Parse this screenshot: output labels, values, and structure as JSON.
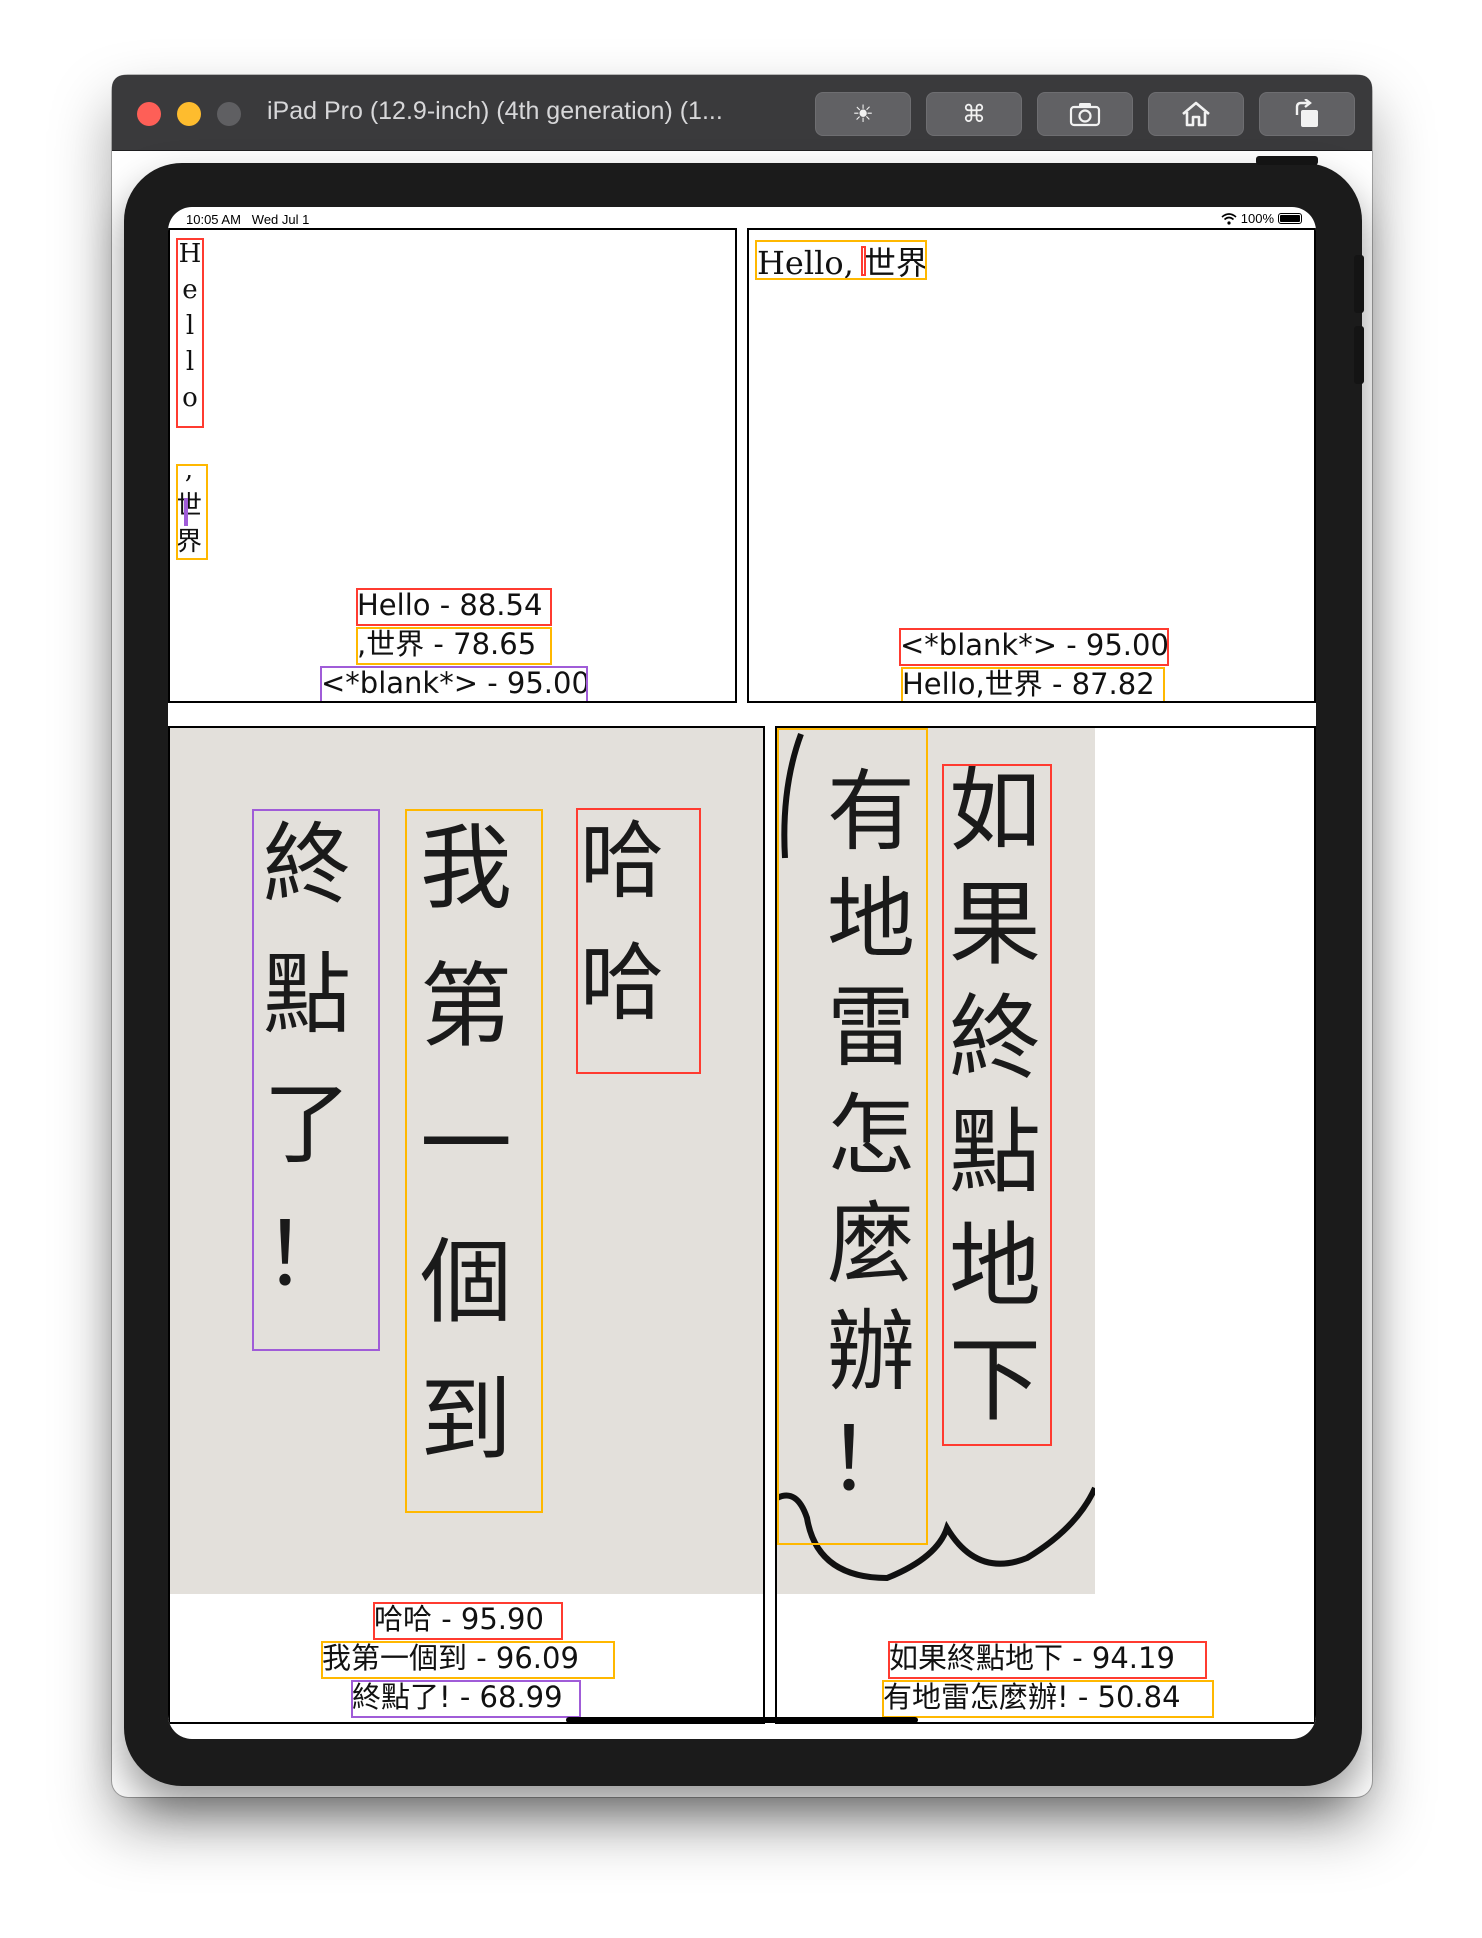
{
  "window": {
    "title": "iPad Pro (12.9-inch) (4th generation) (1...",
    "toolbar": [
      {
        "name": "brightness-button",
        "icon": "sun-icon",
        "glyph": "☀"
      },
      {
        "name": "command-button",
        "icon": "command-icon",
        "glyph": "⌘"
      },
      {
        "name": "screenshot-button",
        "icon": "camera-icon",
        "glyph": "📷"
      },
      {
        "name": "home-button",
        "icon": "home-icon",
        "glyph": "⌂"
      },
      {
        "name": "rotate-button",
        "icon": "rotate-icon",
        "glyph": "↻"
      }
    ]
  },
  "status_bar": {
    "time": "10:05 AM",
    "date": "Wed Jul 1",
    "battery": "100%"
  },
  "panels": {
    "top_left": {
      "vertical_hello": [
        "H",
        "e",
        "l",
        "l",
        "o"
      ],
      "vertical_world": [
        ",",
        "世",
        "界"
      ],
      "results": [
        "Hello - 88.54",
        ",世界 - 78.65",
        "<*blank*> - 95.00"
      ]
    },
    "top_right": {
      "text": "Hello, 世界",
      "results": [
        "<*blank*> - 95.00",
        "Hello,世界 - 87.82"
      ]
    },
    "bottom_left": {
      "columns": {
        "col1": [
          "哈",
          "哈"
        ],
        "col2": [
          "我",
          "第",
          "一",
          "個",
          "到"
        ],
        "col3": [
          "終",
          "點",
          "了",
          "！"
        ]
      },
      "results": [
        "哈哈 - 95.90",
        "我第一個到 - 96.09",
        "終點了! - 68.99"
      ]
    },
    "bottom_right": {
      "columns": {
        "col1": [
          "如",
          "果",
          "終",
          "點",
          "地",
          "下"
        ],
        "col2": [
          "有",
          "地",
          "雷",
          "怎",
          "麼",
          "辦",
          "！"
        ]
      },
      "results": [
        "如果終點地下 - 94.19",
        "有地雷怎麼辦! - 50.84"
      ]
    }
  }
}
